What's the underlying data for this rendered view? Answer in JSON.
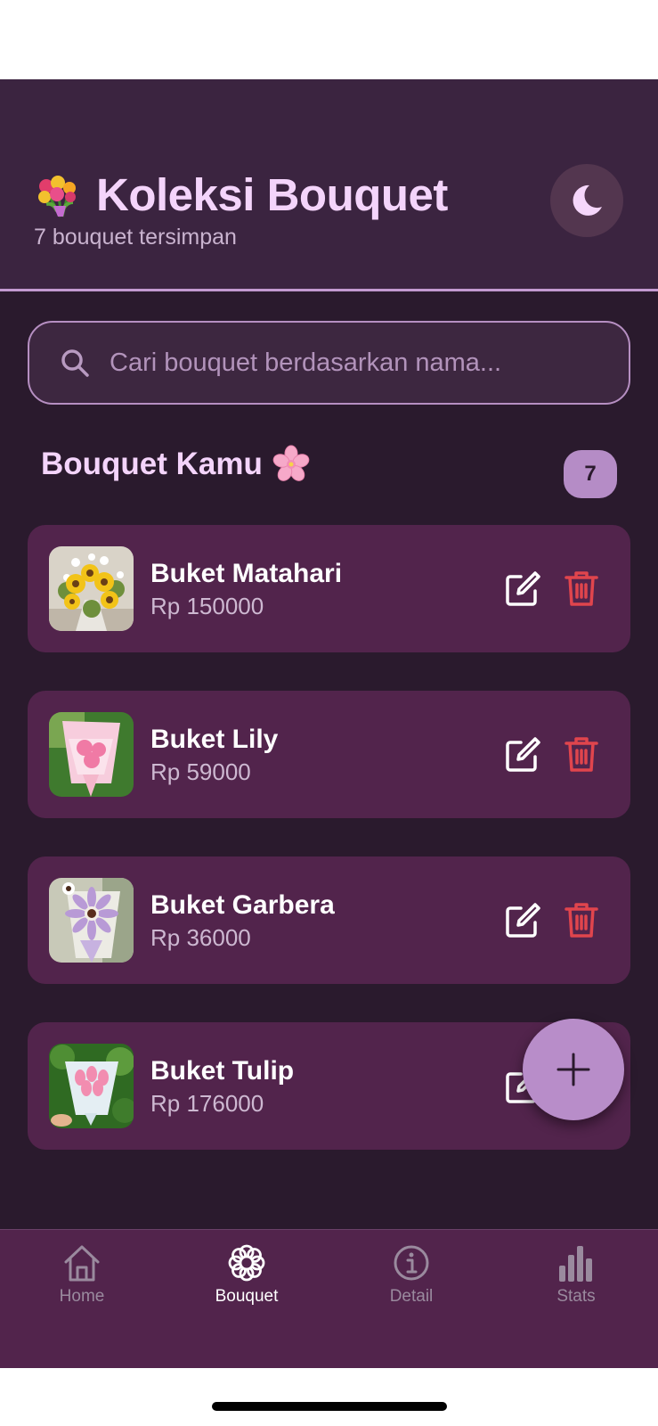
{
  "header": {
    "title": "Koleksi Bouquet",
    "subtitle": "7 bouquet tersimpan",
    "title_icon": "bouquet-emoji",
    "theme_toggle_icon": "moon-icon"
  },
  "search": {
    "placeholder": "Cari bouquet berdasarkan nama...",
    "value": ""
  },
  "section": {
    "title": "Bouquet Kamu",
    "title_icon": "cherry-blossom-emoji",
    "count": "7"
  },
  "bouquets": [
    {
      "name": "Buket Matahari",
      "price": "Rp 150000",
      "image": "sunflower-bouquet-photo"
    },
    {
      "name": "Buket Lily",
      "price": "Rp 59000",
      "image": "pink-lily-bouquet-photo"
    },
    {
      "name": "Buket Garbera",
      "price": "Rp 36000",
      "image": "purple-gerbera-bouquet-photo"
    },
    {
      "name": "Buket Tulip",
      "price": "Rp 176000",
      "image": "pink-tulip-bouquet-photo"
    }
  ],
  "fab": {
    "icon": "plus-icon"
  },
  "nav": {
    "items": [
      {
        "label": "Home",
        "icon": "home-icon",
        "active": false
      },
      {
        "label": "Bouquet",
        "icon": "flower-icon",
        "active": true
      },
      {
        "label": "Detail",
        "icon": "info-icon",
        "active": false
      },
      {
        "label": "Stats",
        "icon": "bar-chart-icon",
        "active": false
      }
    ]
  },
  "colors": {
    "header_bg": "#3b2440",
    "main_bg": "#2a1a2d",
    "card_bg": "#52244c",
    "accent": "#b88dc9",
    "title_text": "#f4d4fb",
    "delete_red": "#e0454d"
  }
}
